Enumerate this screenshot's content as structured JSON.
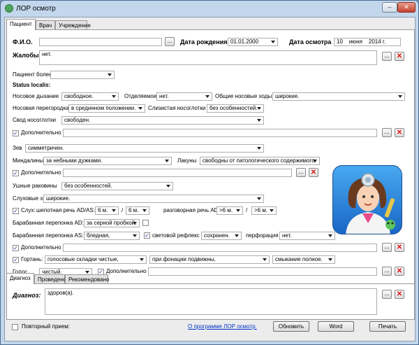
{
  "window": {
    "title": "ЛОР осмотр",
    "min": "–",
    "close": "✕"
  },
  "tabs_top": [
    "Пациент",
    "Врач",
    "Учреждение"
  ],
  "patient": {
    "fio_label": "Ф.И.О.",
    "fio_value": "",
    "btn_dots": "...",
    "birth_label": "Дата рождения",
    "birth_value": "01.01.2000",
    "exam_label": "Дата осмотра",
    "exam_day": "10",
    "exam_month": "июня",
    "exam_year": "2014 г."
  },
  "complaints": {
    "label": "Жалобы",
    "colon": ":",
    "value": "нет."
  },
  "sick": {
    "label": "Пациент болен",
    "value": ""
  },
  "status_label": "Status localis:",
  "nose": {
    "breath_label": "Носовое дыхание",
    "breath_value": "свободное.",
    "discharge_label": "Отделяемое",
    "discharge_value": "нет.",
    "passages_label": "Общие носовые ходы",
    "passages_value": "широкие.",
    "septum_label": "Носовая перегородка",
    "septum_value": "в срединном положении.",
    "mucosa_label": "Слизистая носоглотки",
    "mucosa_value": "без особенностей.",
    "vault_label": "Свод носоглотки",
    "vault_value": "свободен.",
    "extra_label": "Дополнительно",
    "extra_value": ""
  },
  "throat": {
    "pharynx_label": "Зев",
    "pharynx_value": "симметричен.",
    "tonsils_label": "Миндалины",
    "tonsils_value": "за небными дужками.",
    "lacunae_label": "Лакуны",
    "lacunae_value": "свободны от патологического содержимого.",
    "extra_label": "Дополнительно",
    "extra_value": ""
  },
  "ear": {
    "shells_label": "Ушные раковины",
    "shells_value": "без особенностей.",
    "canals_label": "Слуховые ходы",
    "canals_value": "широкие.",
    "hearing_label": "Слух:",
    "whisper_label": "шепотная речь AD/AS:",
    "whisper_ad": "6 м.",
    "slash": "/",
    "whisper_as": "6 м.",
    "speech_label": "разговорная речь AD/AS:",
    "speech_ad": ">6 м.",
    "speech_as": ">6 м.",
    "ad_label": "Барабанная перепонка AD:",
    "ad_value": "за серной пробкой.",
    "as_label": "Барабанная перепонка AS:",
    "as_value": "бледная,",
    "reflex_label": "световой рефлекс",
    "reflex_value": "сохранен.",
    "perf_label": "перфорация",
    "perf_value": "нет.",
    "extra_label": "Дополнительно",
    "extra_value": ""
  },
  "larynx": {
    "label": "Гортань:",
    "folds_value": "голосовые складки чистые,",
    "phonation_value": "при фонации подвижны,",
    "closure_value": "смыкание полное.",
    "voice_label": "Голос",
    "voice_value": "чистый.",
    "extra_label": "Дополнительно",
    "extra_value": ""
  },
  "tabs_bottom": [
    "Диагноз",
    "Проведено",
    "Рекомендовано"
  ],
  "diagnosis": {
    "label": "Диагноз",
    "colon": ":",
    "value": "здоров(а)."
  },
  "footer": {
    "repeat_label": "Повторный прием:",
    "about_link": "О программе ЛОР осмотр.",
    "refresh_btn": "Обновить",
    "word_btn": "Word",
    "print_btn": "Печать"
  },
  "checks": {
    "on": "✓",
    "off": ""
  },
  "icons": {
    "x": "✕"
  }
}
